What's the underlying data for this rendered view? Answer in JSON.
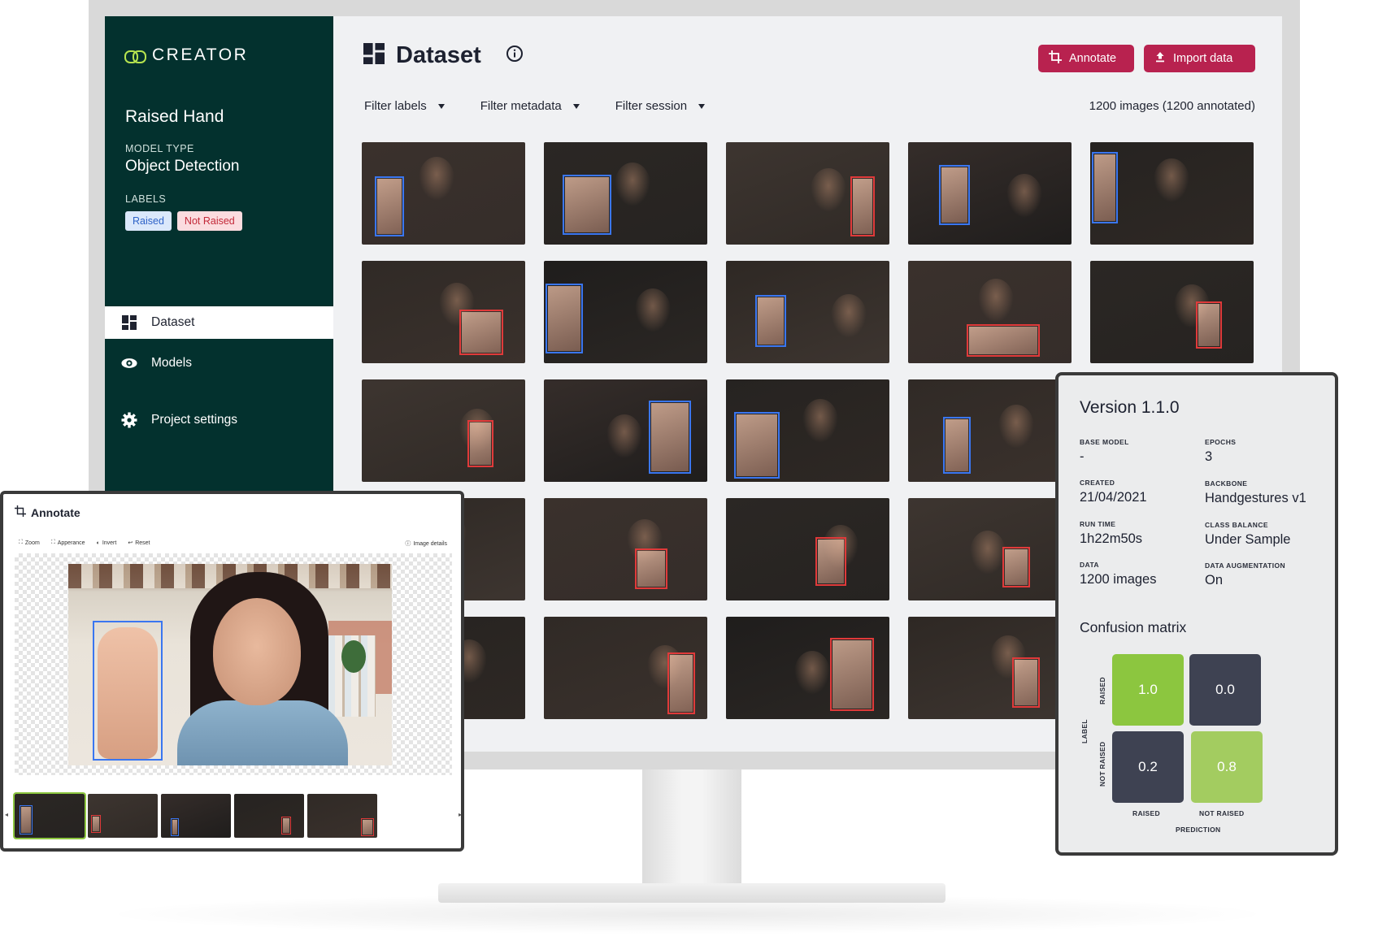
{
  "app": {
    "brand": "CREATOR",
    "project_title": "Raised Hand",
    "model_type_label": "MODEL TYPE",
    "model_type_value": "Object Detection",
    "labels_label": "LABELS",
    "labels": [
      "Raised",
      "Not Raised"
    ]
  },
  "nav": {
    "items": [
      {
        "label": "Dataset",
        "icon": "grid-icon"
      },
      {
        "label": "Models",
        "icon": "eye-icon"
      },
      {
        "label": "Project settings",
        "icon": "gear-icon"
      }
    ]
  },
  "main": {
    "title": "Dataset",
    "annotate_label": "Annotate",
    "import_label": "Import data",
    "filters": [
      "Filter labels",
      "Filter metadata",
      "Filter session"
    ],
    "count": "1200 images (1200 annotated)"
  },
  "colors": {
    "sidebar": "#03312e",
    "accent": "#b8224f",
    "raised_box": "#3a76f0",
    "not_raised_box": "#e03a3a",
    "cm_high": "#8cc63f",
    "cm_mid": "#a3cc60",
    "cm_low": "#3e4252"
  },
  "annotate": {
    "title": "Annotate",
    "tools": [
      "Zoom",
      "Apperance",
      "Invert",
      "Reset"
    ],
    "details": "Image details"
  },
  "version": {
    "title": "Version 1.1.0",
    "fields": [
      {
        "label": "BASE MODEL",
        "value": "-"
      },
      {
        "label": "EPOCHS",
        "value": "3"
      },
      {
        "label": "CREATED",
        "value": "21/04/2021"
      },
      {
        "label": "BACKBONE",
        "value": "Handgestures v1"
      },
      {
        "label": "RUN TIME",
        "value": "1h22m50s"
      },
      {
        "label": "CLASS BALANCE",
        "value": "Under Sample"
      },
      {
        "label": "DATA",
        "value": "1200 images"
      },
      {
        "label": "DATA AUGMENTATION",
        "value": "On"
      }
    ],
    "confusion_title": "Confusion matrix",
    "matrix": [
      [
        "1.0",
        "0.0"
      ],
      [
        "0.2",
        "0.8"
      ]
    ],
    "row_labels": [
      "RAISED",
      "NOT RAISED"
    ],
    "col_labels": [
      "RAISED",
      "NOT RAISED"
    ],
    "y_axis": "LABEL",
    "x_axis": "PREDICTION"
  }
}
